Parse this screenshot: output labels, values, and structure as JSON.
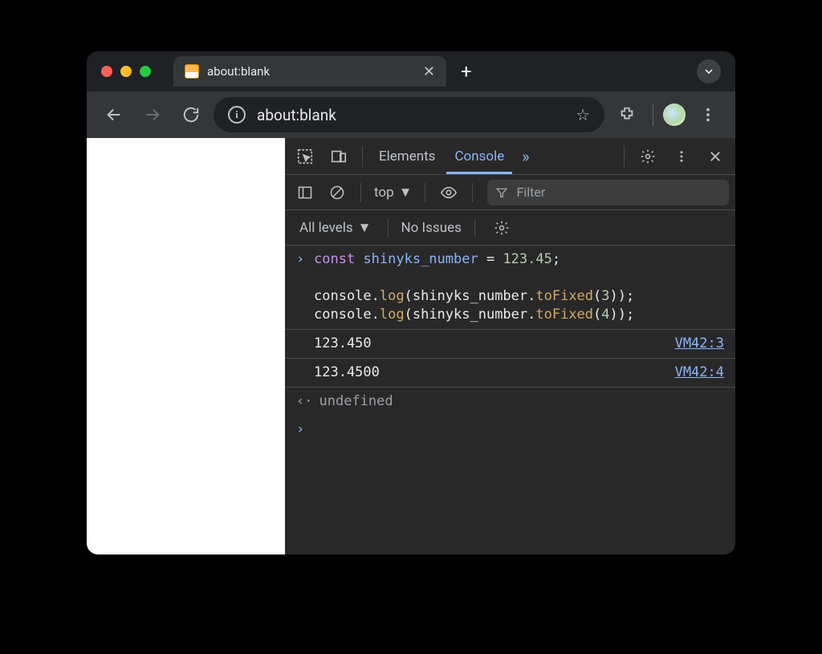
{
  "tab": {
    "title": "about:blank"
  },
  "toolbar": {
    "url": "about:blank"
  },
  "devtools": {
    "tabs": {
      "elements": "Elements",
      "console": "Console",
      "more": "»"
    },
    "context_label": "top",
    "filter_placeholder": "Filter",
    "levels_label": "All levels",
    "issues_label": "No Issues"
  },
  "console": {
    "input_code": {
      "l1_kw": "const",
      "l1_ident": " shinyks_number",
      "l1_rest": " = ",
      "l1_num": "123.45",
      "l1_end": ";",
      "l3_a": "console.",
      "l3_m": "log",
      "l3_b": "(shinyks_number.",
      "l3_m2": "toFixed",
      "l3_c": "(",
      "l3_n": "3",
      "l3_d": "));",
      "l4_a": "console.",
      "l4_m": "log",
      "l4_b": "(shinyks_number.",
      "l4_m2": "toFixed",
      "l4_c": "(",
      "l4_n": "4",
      "l4_d": "));"
    },
    "outputs": [
      {
        "value": "123.450",
        "source": "VM42:3"
      },
      {
        "value": "123.4500",
        "source": "VM42:4"
      }
    ],
    "return_value": "undefined"
  }
}
